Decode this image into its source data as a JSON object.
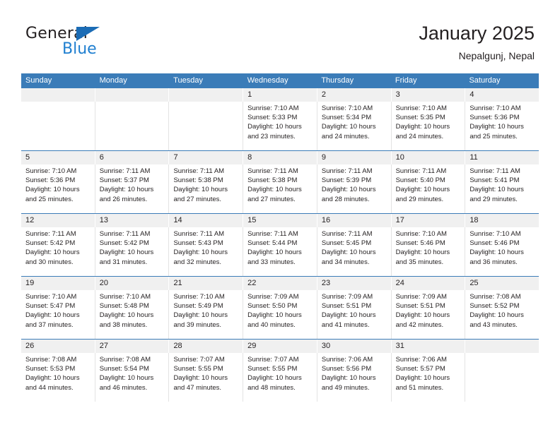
{
  "brand": {
    "name_top": "General",
    "name_bottom": "Blue",
    "triangle_icon": "blue-triangle-logo-mark",
    "color_dark": "#231f20",
    "color_blue": "#1f7fd0"
  },
  "header": {
    "title": "January 2025",
    "subtitle": "Nepalgunj, Nepal"
  },
  "theme": {
    "header_blue": "#3b7cb8",
    "daynum_band": "#f0f0f0",
    "text": "#231f20",
    "cell_border": "#e3e3e3"
  },
  "weekdays": [
    "Sunday",
    "Monday",
    "Tuesday",
    "Wednesday",
    "Thursday",
    "Friday",
    "Saturday"
  ],
  "weeks": [
    {
      "days": [
        {
          "num": "",
          "lines": []
        },
        {
          "num": "",
          "lines": []
        },
        {
          "num": "",
          "lines": []
        },
        {
          "num": "1",
          "lines": [
            "Sunrise: 7:10 AM",
            "Sunset: 5:33 PM",
            "Daylight: 10 hours",
            "and 23 minutes."
          ]
        },
        {
          "num": "2",
          "lines": [
            "Sunrise: 7:10 AM",
            "Sunset: 5:34 PM",
            "Daylight: 10 hours",
            "and 24 minutes."
          ]
        },
        {
          "num": "3",
          "lines": [
            "Sunrise: 7:10 AM",
            "Sunset: 5:35 PM",
            "Daylight: 10 hours",
            "and 24 minutes."
          ]
        },
        {
          "num": "4",
          "lines": [
            "Sunrise: 7:10 AM",
            "Sunset: 5:36 PM",
            "Daylight: 10 hours",
            "and 25 minutes."
          ]
        }
      ]
    },
    {
      "days": [
        {
          "num": "5",
          "lines": [
            "Sunrise: 7:10 AM",
            "Sunset: 5:36 PM",
            "Daylight: 10 hours",
            "and 25 minutes."
          ]
        },
        {
          "num": "6",
          "lines": [
            "Sunrise: 7:11 AM",
            "Sunset: 5:37 PM",
            "Daylight: 10 hours",
            "and 26 minutes."
          ]
        },
        {
          "num": "7",
          "lines": [
            "Sunrise: 7:11 AM",
            "Sunset: 5:38 PM",
            "Daylight: 10 hours",
            "and 27 minutes."
          ]
        },
        {
          "num": "8",
          "lines": [
            "Sunrise: 7:11 AM",
            "Sunset: 5:38 PM",
            "Daylight: 10 hours",
            "and 27 minutes."
          ]
        },
        {
          "num": "9",
          "lines": [
            "Sunrise: 7:11 AM",
            "Sunset: 5:39 PM",
            "Daylight: 10 hours",
            "and 28 minutes."
          ]
        },
        {
          "num": "10",
          "lines": [
            "Sunrise: 7:11 AM",
            "Sunset: 5:40 PM",
            "Daylight: 10 hours",
            "and 29 minutes."
          ]
        },
        {
          "num": "11",
          "lines": [
            "Sunrise: 7:11 AM",
            "Sunset: 5:41 PM",
            "Daylight: 10 hours",
            "and 29 minutes."
          ]
        }
      ]
    },
    {
      "days": [
        {
          "num": "12",
          "lines": [
            "Sunrise: 7:11 AM",
            "Sunset: 5:42 PM",
            "Daylight: 10 hours",
            "and 30 minutes."
          ]
        },
        {
          "num": "13",
          "lines": [
            "Sunrise: 7:11 AM",
            "Sunset: 5:42 PM",
            "Daylight: 10 hours",
            "and 31 minutes."
          ]
        },
        {
          "num": "14",
          "lines": [
            "Sunrise: 7:11 AM",
            "Sunset: 5:43 PM",
            "Daylight: 10 hours",
            "and 32 minutes."
          ]
        },
        {
          "num": "15",
          "lines": [
            "Sunrise: 7:11 AM",
            "Sunset: 5:44 PM",
            "Daylight: 10 hours",
            "and 33 minutes."
          ]
        },
        {
          "num": "16",
          "lines": [
            "Sunrise: 7:11 AM",
            "Sunset: 5:45 PM",
            "Daylight: 10 hours",
            "and 34 minutes."
          ]
        },
        {
          "num": "17",
          "lines": [
            "Sunrise: 7:10 AM",
            "Sunset: 5:46 PM",
            "Daylight: 10 hours",
            "and 35 minutes."
          ]
        },
        {
          "num": "18",
          "lines": [
            "Sunrise: 7:10 AM",
            "Sunset: 5:46 PM",
            "Daylight: 10 hours",
            "and 36 minutes."
          ]
        }
      ]
    },
    {
      "days": [
        {
          "num": "19",
          "lines": [
            "Sunrise: 7:10 AM",
            "Sunset: 5:47 PM",
            "Daylight: 10 hours",
            "and 37 minutes."
          ]
        },
        {
          "num": "20",
          "lines": [
            "Sunrise: 7:10 AM",
            "Sunset: 5:48 PM",
            "Daylight: 10 hours",
            "and 38 minutes."
          ]
        },
        {
          "num": "21",
          "lines": [
            "Sunrise: 7:10 AM",
            "Sunset: 5:49 PM",
            "Daylight: 10 hours",
            "and 39 minutes."
          ]
        },
        {
          "num": "22",
          "lines": [
            "Sunrise: 7:09 AM",
            "Sunset: 5:50 PM",
            "Daylight: 10 hours",
            "and 40 minutes."
          ]
        },
        {
          "num": "23",
          "lines": [
            "Sunrise: 7:09 AM",
            "Sunset: 5:51 PM",
            "Daylight: 10 hours",
            "and 41 minutes."
          ]
        },
        {
          "num": "24",
          "lines": [
            "Sunrise: 7:09 AM",
            "Sunset: 5:51 PM",
            "Daylight: 10 hours",
            "and 42 minutes."
          ]
        },
        {
          "num": "25",
          "lines": [
            "Sunrise: 7:08 AM",
            "Sunset: 5:52 PM",
            "Daylight: 10 hours",
            "and 43 minutes."
          ]
        }
      ]
    },
    {
      "days": [
        {
          "num": "26",
          "lines": [
            "Sunrise: 7:08 AM",
            "Sunset: 5:53 PM",
            "Daylight: 10 hours",
            "and 44 minutes."
          ]
        },
        {
          "num": "27",
          "lines": [
            "Sunrise: 7:08 AM",
            "Sunset: 5:54 PM",
            "Daylight: 10 hours",
            "and 46 minutes."
          ]
        },
        {
          "num": "28",
          "lines": [
            "Sunrise: 7:07 AM",
            "Sunset: 5:55 PM",
            "Daylight: 10 hours",
            "and 47 minutes."
          ]
        },
        {
          "num": "29",
          "lines": [
            "Sunrise: 7:07 AM",
            "Sunset: 5:55 PM",
            "Daylight: 10 hours",
            "and 48 minutes."
          ]
        },
        {
          "num": "30",
          "lines": [
            "Sunrise: 7:06 AM",
            "Sunset: 5:56 PM",
            "Daylight: 10 hours",
            "and 49 minutes."
          ]
        },
        {
          "num": "31",
          "lines": [
            "Sunrise: 7:06 AM",
            "Sunset: 5:57 PM",
            "Daylight: 10 hours",
            "and 51 minutes."
          ]
        },
        {
          "num": "",
          "lines": []
        }
      ]
    }
  ]
}
